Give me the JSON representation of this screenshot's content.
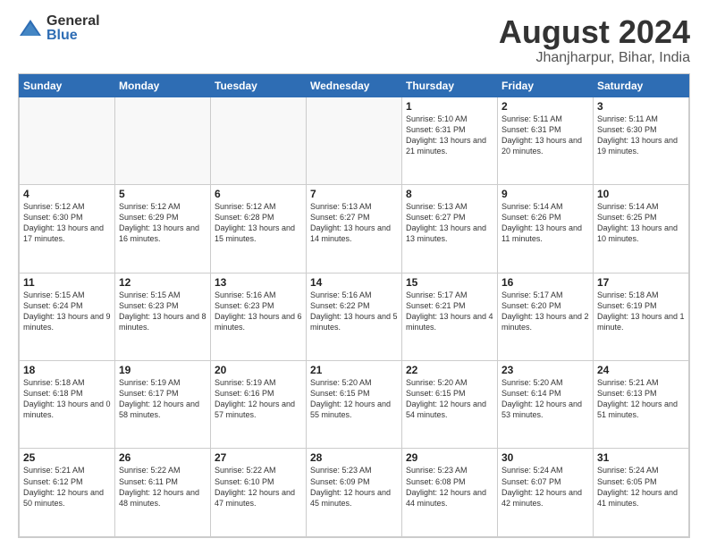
{
  "header": {
    "logo_general": "General",
    "logo_blue": "Blue",
    "month_title": "August 2024",
    "location": "Jhanjharpur, Bihar, India"
  },
  "days_of_week": [
    "Sunday",
    "Monday",
    "Tuesday",
    "Wednesday",
    "Thursday",
    "Friday",
    "Saturday"
  ],
  "weeks": [
    [
      {
        "day": "",
        "info": "",
        "empty": true
      },
      {
        "day": "",
        "info": "",
        "empty": true
      },
      {
        "day": "",
        "info": "",
        "empty": true
      },
      {
        "day": "",
        "info": "",
        "empty": true
      },
      {
        "day": "1",
        "info": "Sunrise: 5:10 AM\nSunset: 6:31 PM\nDaylight: 13 hours\nand 21 minutes.",
        "empty": false
      },
      {
        "day": "2",
        "info": "Sunrise: 5:11 AM\nSunset: 6:31 PM\nDaylight: 13 hours\nand 20 minutes.",
        "empty": false
      },
      {
        "day": "3",
        "info": "Sunrise: 5:11 AM\nSunset: 6:30 PM\nDaylight: 13 hours\nand 19 minutes.",
        "empty": false
      }
    ],
    [
      {
        "day": "4",
        "info": "Sunrise: 5:12 AM\nSunset: 6:30 PM\nDaylight: 13 hours\nand 17 minutes.",
        "empty": false
      },
      {
        "day": "5",
        "info": "Sunrise: 5:12 AM\nSunset: 6:29 PM\nDaylight: 13 hours\nand 16 minutes.",
        "empty": false
      },
      {
        "day": "6",
        "info": "Sunrise: 5:12 AM\nSunset: 6:28 PM\nDaylight: 13 hours\nand 15 minutes.",
        "empty": false
      },
      {
        "day": "7",
        "info": "Sunrise: 5:13 AM\nSunset: 6:27 PM\nDaylight: 13 hours\nand 14 minutes.",
        "empty": false
      },
      {
        "day": "8",
        "info": "Sunrise: 5:13 AM\nSunset: 6:27 PM\nDaylight: 13 hours\nand 13 minutes.",
        "empty": false
      },
      {
        "day": "9",
        "info": "Sunrise: 5:14 AM\nSunset: 6:26 PM\nDaylight: 13 hours\nand 11 minutes.",
        "empty": false
      },
      {
        "day": "10",
        "info": "Sunrise: 5:14 AM\nSunset: 6:25 PM\nDaylight: 13 hours\nand 10 minutes.",
        "empty": false
      }
    ],
    [
      {
        "day": "11",
        "info": "Sunrise: 5:15 AM\nSunset: 6:24 PM\nDaylight: 13 hours\nand 9 minutes.",
        "empty": false
      },
      {
        "day": "12",
        "info": "Sunrise: 5:15 AM\nSunset: 6:23 PM\nDaylight: 13 hours\nand 8 minutes.",
        "empty": false
      },
      {
        "day": "13",
        "info": "Sunrise: 5:16 AM\nSunset: 6:23 PM\nDaylight: 13 hours\nand 6 minutes.",
        "empty": false
      },
      {
        "day": "14",
        "info": "Sunrise: 5:16 AM\nSunset: 6:22 PM\nDaylight: 13 hours\nand 5 minutes.",
        "empty": false
      },
      {
        "day": "15",
        "info": "Sunrise: 5:17 AM\nSunset: 6:21 PM\nDaylight: 13 hours\nand 4 minutes.",
        "empty": false
      },
      {
        "day": "16",
        "info": "Sunrise: 5:17 AM\nSunset: 6:20 PM\nDaylight: 13 hours\nand 2 minutes.",
        "empty": false
      },
      {
        "day": "17",
        "info": "Sunrise: 5:18 AM\nSunset: 6:19 PM\nDaylight: 13 hours\nand 1 minute.",
        "empty": false
      }
    ],
    [
      {
        "day": "18",
        "info": "Sunrise: 5:18 AM\nSunset: 6:18 PM\nDaylight: 13 hours\nand 0 minutes.",
        "empty": false
      },
      {
        "day": "19",
        "info": "Sunrise: 5:19 AM\nSunset: 6:17 PM\nDaylight: 12 hours\nand 58 minutes.",
        "empty": false
      },
      {
        "day": "20",
        "info": "Sunrise: 5:19 AM\nSunset: 6:16 PM\nDaylight: 12 hours\nand 57 minutes.",
        "empty": false
      },
      {
        "day": "21",
        "info": "Sunrise: 5:20 AM\nSunset: 6:15 PM\nDaylight: 12 hours\nand 55 minutes.",
        "empty": false
      },
      {
        "day": "22",
        "info": "Sunrise: 5:20 AM\nSunset: 6:15 PM\nDaylight: 12 hours\nand 54 minutes.",
        "empty": false
      },
      {
        "day": "23",
        "info": "Sunrise: 5:20 AM\nSunset: 6:14 PM\nDaylight: 12 hours\nand 53 minutes.",
        "empty": false
      },
      {
        "day": "24",
        "info": "Sunrise: 5:21 AM\nSunset: 6:13 PM\nDaylight: 12 hours\nand 51 minutes.",
        "empty": false
      }
    ],
    [
      {
        "day": "25",
        "info": "Sunrise: 5:21 AM\nSunset: 6:12 PM\nDaylight: 12 hours\nand 50 minutes.",
        "empty": false
      },
      {
        "day": "26",
        "info": "Sunrise: 5:22 AM\nSunset: 6:11 PM\nDaylight: 12 hours\nand 48 minutes.",
        "empty": false
      },
      {
        "day": "27",
        "info": "Sunrise: 5:22 AM\nSunset: 6:10 PM\nDaylight: 12 hours\nand 47 minutes.",
        "empty": false
      },
      {
        "day": "28",
        "info": "Sunrise: 5:23 AM\nSunset: 6:09 PM\nDaylight: 12 hours\nand 45 minutes.",
        "empty": false
      },
      {
        "day": "29",
        "info": "Sunrise: 5:23 AM\nSunset: 6:08 PM\nDaylight: 12 hours\nand 44 minutes.",
        "empty": false
      },
      {
        "day": "30",
        "info": "Sunrise: 5:24 AM\nSunset: 6:07 PM\nDaylight: 12 hours\nand 42 minutes.",
        "empty": false
      },
      {
        "day": "31",
        "info": "Sunrise: 5:24 AM\nSunset: 6:05 PM\nDaylight: 12 hours\nand 41 minutes.",
        "empty": false
      }
    ]
  ]
}
